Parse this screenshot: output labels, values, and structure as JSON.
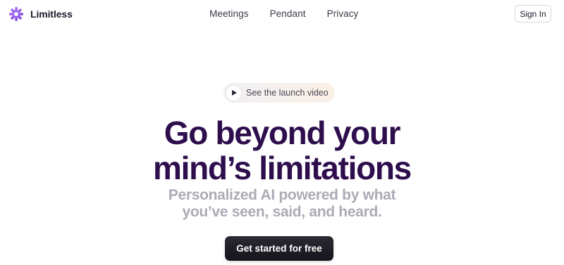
{
  "brand": {
    "name": "Limitless",
    "logo_icon": "limitless-star-logo",
    "logo_color": "#9a5cf0"
  },
  "nav": {
    "items": [
      {
        "label": "Meetings"
      },
      {
        "label": "Pendant"
      },
      {
        "label": "Privacy"
      }
    ]
  },
  "header": {
    "sign_in_label": "Sign In"
  },
  "launch": {
    "label": "See the launch video",
    "icon": "play-icon"
  },
  "hero": {
    "title_line1": "Go beyond your",
    "title_line2": "mind’s limitations",
    "subtitle_line1": "Personalized AI powered by what",
    "subtitle_line2": "you’ve seen, said, and heard.",
    "title_color": "#2e0e4d",
    "subtitle_color": "#aeaab6"
  },
  "cta": {
    "label": "Get started for free",
    "color": "#1c1b22"
  }
}
